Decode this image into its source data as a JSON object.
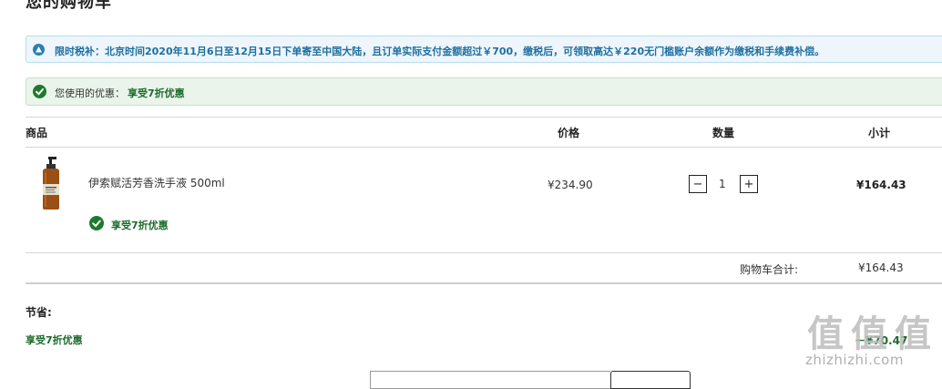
{
  "page": {
    "title": "您的购物车"
  },
  "notice": {
    "text": "限时税补：北京时间2020年11月6日至12月15日下单寄至中国大陆，且订单实际支付金额超过￥700，缴税后，可领取高达￥220无门槛账户余额作为缴税和手续费补偿。",
    "icon": "info-icon",
    "color": "#1f6f9f"
  },
  "discount_banner": {
    "label": "您使用的优惠：",
    "value": "享受7折优惠",
    "icon": "check-circle-icon",
    "color": "#1c7a2c"
  },
  "table": {
    "headers": {
      "product": "商品",
      "price": "价格",
      "quantity": "数量",
      "subtotal": "小计"
    }
  },
  "item": {
    "name": "伊索赋活芳香洗手液 500ml",
    "promo": "享受7折优惠",
    "price": "¥234.90",
    "quantity": "1",
    "decrement_label": "−",
    "increment_label": "+",
    "subtotal": "¥164.43"
  },
  "cart_total": {
    "label": "购物车合计:",
    "value": "¥164.43"
  },
  "savings": {
    "title": "节省:",
    "name": "享受7折优惠",
    "amount": "－¥70.47"
  },
  "watermark": {
    "glyph": "值",
    "site": "zhizhizhi.com"
  }
}
